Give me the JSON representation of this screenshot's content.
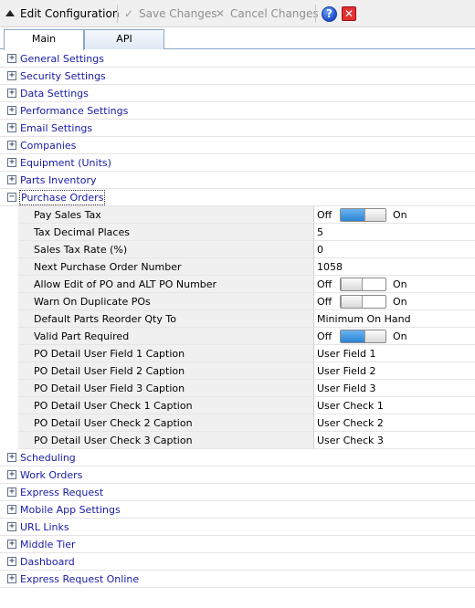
{
  "toolbar": {
    "title": "Edit Configuration",
    "save_label": "Save Changes",
    "cancel_label": "Cancel Changes"
  },
  "tabs": [
    {
      "label": "Main",
      "active": true
    },
    {
      "label": "API",
      "active": false
    }
  ],
  "categories_before": [
    "General Settings",
    "Security Settings",
    "Data Settings",
    "Performance Settings",
    "Email Settings",
    "Companies",
    "Equipment (Units)",
    "Parts Inventory"
  ],
  "expanded_category": {
    "label": "Purchase Orders",
    "properties": [
      {
        "name": "Pay Sales Tax",
        "type": "toggle",
        "value": true
      },
      {
        "name": "Tax Decimal Places",
        "type": "text",
        "value": "5"
      },
      {
        "name": "Sales Tax Rate (%)",
        "type": "text",
        "value": "0"
      },
      {
        "name": "Next Purchase Order Number",
        "type": "text",
        "value": "1058"
      },
      {
        "name": "Allow Edit of PO and ALT PO Number",
        "type": "toggle",
        "value": false
      },
      {
        "name": "Warn On Duplicate POs",
        "type": "toggle",
        "value": false
      },
      {
        "name": "Default Parts Reorder Qty To",
        "type": "text",
        "value": "Minimum On Hand"
      },
      {
        "name": "Valid Part Required",
        "type": "toggle",
        "value": true
      },
      {
        "name": "PO Detail User Field 1 Caption",
        "type": "text",
        "value": "User Field 1"
      },
      {
        "name": "PO Detail User Field 2 Caption",
        "type": "text",
        "value": "User Field 2"
      },
      {
        "name": "PO Detail User Field 3 Caption",
        "type": "text",
        "value": "User Field 3"
      },
      {
        "name": "PO Detail User Check 1 Caption",
        "type": "text",
        "value": "User Check 1"
      },
      {
        "name": "PO Detail User Check 2 Caption",
        "type": "text",
        "value": "User Check 2"
      },
      {
        "name": "PO Detail User Check 3 Caption",
        "type": "text",
        "value": "User Check 3"
      }
    ]
  },
  "categories_after": [
    "Scheduling",
    "Work Orders",
    "Express Request",
    "Mobile App Settings",
    "URL Links",
    "Middle Tier",
    "Dashboard",
    "Express Request Online"
  ],
  "toggle_labels": {
    "off": "Off",
    "on": "On"
  },
  "colors": {
    "category_text": "#1a1aa6",
    "switch_on": "#2d84d6"
  }
}
